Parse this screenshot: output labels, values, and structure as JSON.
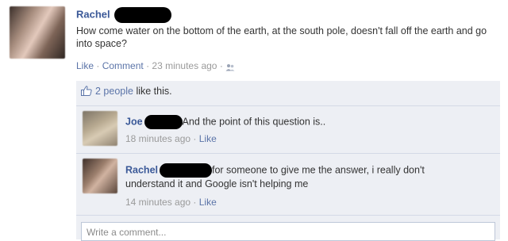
{
  "post": {
    "author": "Rachel",
    "text": "How come water on the bottom of the earth, at the south pole, doesn't fall off the earth and go into space?",
    "actions": {
      "like": "Like",
      "comment": "Comment",
      "time": "23 minutes ago"
    },
    "separator": "·"
  },
  "likes": {
    "count_link": "2 people",
    "suffix": "like this."
  },
  "comments": [
    {
      "author": "Joe",
      "text": "And the point of this question is..",
      "time": "18 minutes ago",
      "like": "Like"
    },
    {
      "author": "Rachel",
      "text_line1": "for someone to give me the answer, i really don't",
      "text_line2": "understand it and Google isn't helping me",
      "time": "14 minutes ago",
      "like": "Like"
    }
  ],
  "composer": {
    "placeholder": "Write a comment..."
  },
  "colors": {
    "link": "#3b5998",
    "feedback_bg": "#edeff4",
    "meta": "#9a9a9a"
  },
  "icons": [
    "people-icon",
    "thumbs-up-icon"
  ]
}
